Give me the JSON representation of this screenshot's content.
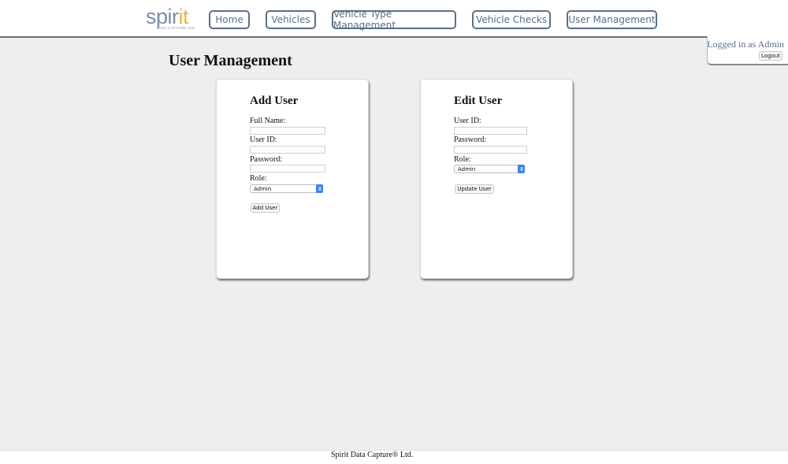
{
  "header": {
    "logo": {
      "text_main": "spir",
      "text_accent": "it",
      "tagline": "DATA CAPTURE LTD"
    },
    "nav": [
      {
        "label": "Home"
      },
      {
        "label": "Vehicles"
      },
      {
        "label": "Vehicle Type Management"
      },
      {
        "label": "Vehicle Checks"
      },
      {
        "label": "User Management"
      }
    ]
  },
  "session": {
    "logged_in_text": "Logged in as Admin",
    "logout_label": "Logout"
  },
  "page": {
    "title": "User Management"
  },
  "add_user": {
    "title": "Add User",
    "full_name_label": "Full Name:",
    "full_name_value": "",
    "user_id_label": "User ID:",
    "user_id_value": "",
    "password_label": "Password:",
    "password_value": "",
    "role_label": "Role:",
    "role_value": "Admin",
    "submit_label": "Add User"
  },
  "edit_user": {
    "title": "Edit User",
    "user_id_label": "User ID:",
    "user_id_value": "",
    "password_label": "Password:",
    "password_value": "",
    "role_label": "Role:",
    "role_value": "Admin",
    "submit_label": "Update User"
  },
  "footer": {
    "text": "Spirit Data Capture® Ltd."
  },
  "colors": {
    "nav_border": "#587089",
    "logo_grey": "#7b8ea6",
    "logo_accent": "#f2b53b",
    "background": "#eeeeee",
    "select_arrow": "#3d84e6"
  }
}
